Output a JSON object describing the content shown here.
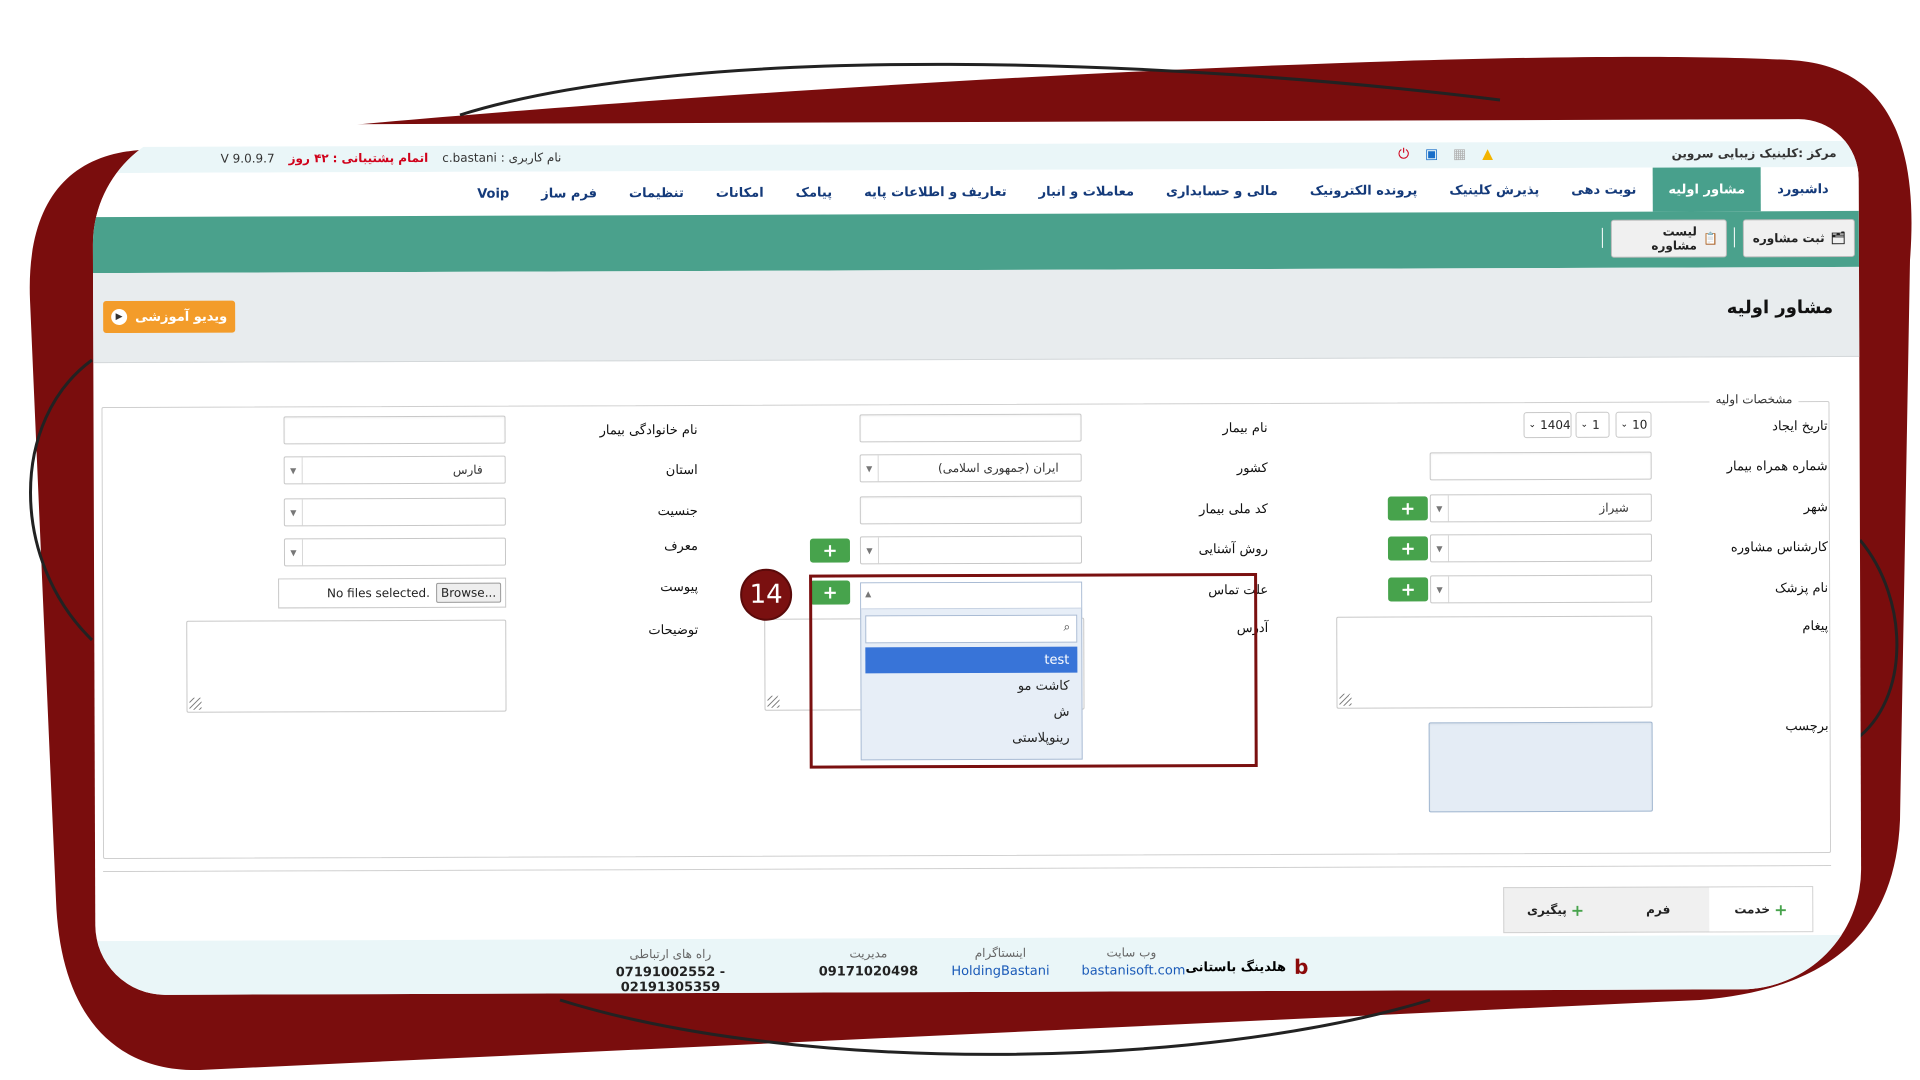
{
  "topbar": {
    "center_name": "مرکز :کلینیک زیبایی سروین",
    "username_label": "نام کاربری :",
    "username": "c.bastani",
    "support_label": "اتمام پشتیبانی :",
    "support_value": "۴۲ روز",
    "version": "V 9.0.9.7"
  },
  "menu": {
    "items": [
      "داشبورد",
      "مشاور اولیه",
      "نوبت دهی",
      "پذیرش کلینیک",
      "پرونده الکترونیک",
      "مالی و حسابداری",
      "معاملات و انبار",
      "تعاریف و اطلاعات پایه",
      "پیامک",
      "امکانات",
      "تنظیمات",
      "فرم ساز",
      "Voip"
    ],
    "active": "مشاور اولیه"
  },
  "toolbar": {
    "new_consult": "ثبت مشاوره",
    "list_consult": "لیست مشاوره"
  },
  "page": {
    "title": "مشاور اولیه",
    "video_button": "ویدیو آموزشی",
    "section_legend": "مشخصات اولیه"
  },
  "form": {
    "created_date_label": "تاریخ ایجاد",
    "date_day": "10",
    "date_month": "1",
    "date_year": "1404",
    "patient_mobile_label": "شماره همراه بیمار",
    "city_label": "شهر",
    "city_value": "شیراز",
    "consultant_label": "کارشناس مشاوره",
    "doctor_label": "نام پزشک",
    "message_label": "پیغام",
    "tag_label": "برچسب",
    "patient_name_label": "نام بیمار",
    "country_label": "کشور",
    "country_value": "ایران (جمهوری اسلامی)",
    "national_code_label": "کد ملی بیمار",
    "acquaintance_label": "روش آشنایی",
    "contact_reason_label": "علت تماس",
    "address_label": "آدرس",
    "family_name_label": "نام خانوادگی بیمار",
    "province_label": "استان",
    "province_value": "فارس",
    "gender_label": "جنسیت",
    "referrer_label": "معرف",
    "attachment_label": "پیوست",
    "file_status": "No files selected.",
    "browse_label": "Browse...",
    "description_label": "توضیحات"
  },
  "contact_reason_dropdown": {
    "search_icon": "magnifier-icon",
    "options": [
      "test",
      "کاشت مو",
      "ش",
      "رینوپلاستی"
    ],
    "highlighted": "test"
  },
  "annotation": {
    "step_number": "14",
    "color": "#7a1010"
  },
  "lower_tabs": {
    "service": "خدمت",
    "form": "فرم",
    "followup": "پیگیری"
  },
  "footer": {
    "brand": "هلدینگ باستانی",
    "website_title": "وب سایت",
    "website_value": "bastanisoft.com",
    "instagram_title": "اینستاگرام",
    "instagram_value": "HoldingBastani",
    "management_title": "مدیریت",
    "management_value": "09171020498",
    "contact_title": "راه های ارتباطی",
    "contact_value": "07191002552 - 02191305359"
  },
  "colors": {
    "frame": "#7a0d0d",
    "accent": "#4aa18c",
    "button_green": "#47a34c",
    "video_orange": "#f39c2a"
  }
}
